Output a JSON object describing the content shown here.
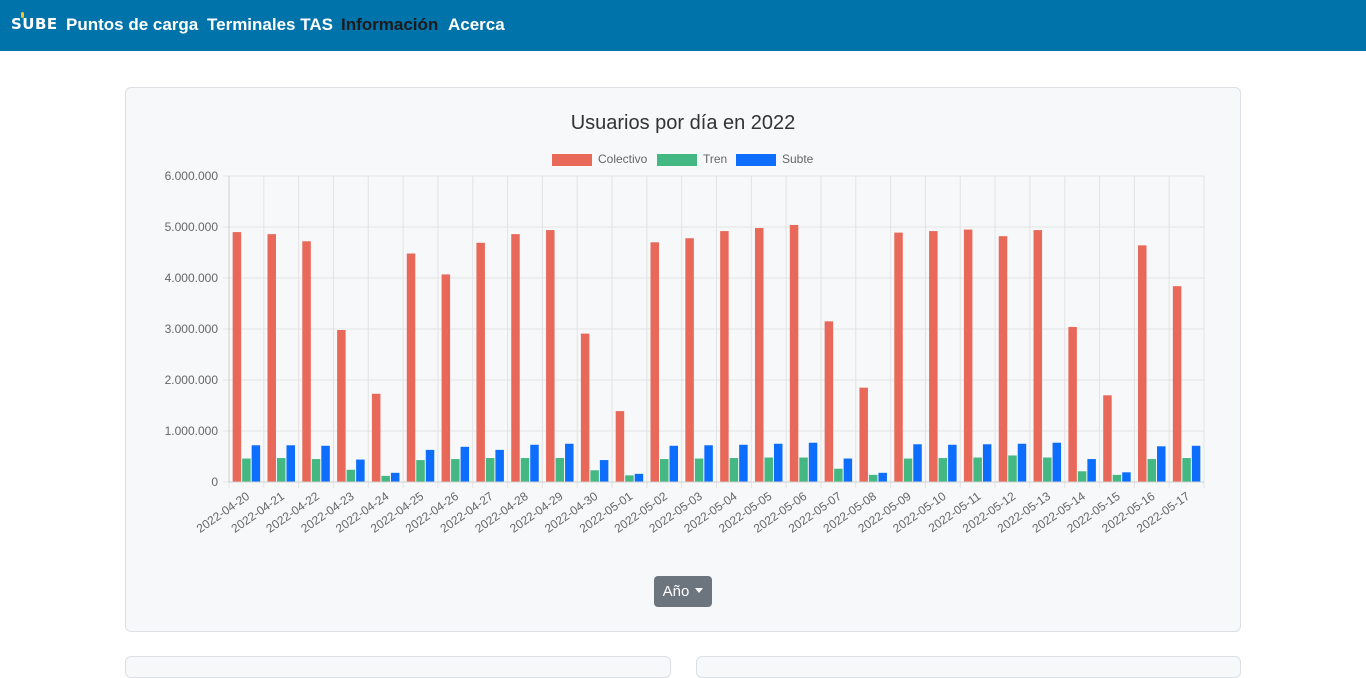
{
  "nav": {
    "brand": "SUBE",
    "links": [
      "Puntos de carga",
      "Terminales TAS",
      "Información",
      "Acerca"
    ],
    "active": "Información"
  },
  "dropdown": {
    "label": "Año"
  },
  "chart_data": {
    "type": "bar",
    "title": "Usuarios por día en 2022",
    "xlabel": "",
    "ylabel": "",
    "ylim": [
      0,
      6000000
    ],
    "yticks": [
      "0",
      "1.000.000",
      "2.000.000",
      "3.000.000",
      "4.000.000",
      "5.000.000",
      "6.000.000"
    ],
    "grid": true,
    "legend": "top",
    "categories": [
      "2022-04-20",
      "2022-04-21",
      "2022-04-22",
      "2022-04-23",
      "2022-04-24",
      "2022-04-25",
      "2022-04-26",
      "2022-04-27",
      "2022-04-28",
      "2022-04-29",
      "2022-04-30",
      "2022-05-01",
      "2022-05-02",
      "2022-05-03",
      "2022-05-04",
      "2022-05-05",
      "2022-05-06",
      "2022-05-07",
      "2022-05-08",
      "2022-05-09",
      "2022-05-10",
      "2022-05-11",
      "2022-05-12",
      "2022-05-13",
      "2022-05-14",
      "2022-05-15",
      "2022-05-16",
      "2022-05-17"
    ],
    "series": [
      {
        "name": "Colectivo",
        "color": "#e8695a",
        "values": [
          4900000,
          4860000,
          4720000,
          2980000,
          1730000,
          4480000,
          4070000,
          4690000,
          4860000,
          4940000,
          2910000,
          1390000,
          4700000,
          4780000,
          4920000,
          4980000,
          5040000,
          3150000,
          1850000,
          4890000,
          4920000,
          4950000,
          4820000,
          4940000,
          3040000,
          1700000,
          4640000,
          3840000
        ]
      },
      {
        "name": "Tren",
        "color": "#43b882",
        "values": [
          460000,
          470000,
          450000,
          240000,
          120000,
          430000,
          450000,
          470000,
          470000,
          470000,
          230000,
          130000,
          450000,
          460000,
          470000,
          480000,
          480000,
          260000,
          140000,
          460000,
          470000,
          480000,
          520000,
          480000,
          210000,
          140000,
          450000,
          470000
        ]
      },
      {
        "name": "Subte",
        "color": "#0d6efd",
        "values": [
          720000,
          720000,
          710000,
          440000,
          180000,
          630000,
          690000,
          630000,
          730000,
          750000,
          430000,
          160000,
          710000,
          720000,
          730000,
          750000,
          770000,
          460000,
          180000,
          740000,
          730000,
          740000,
          750000,
          770000,
          450000,
          190000,
          700000,
          710000
        ]
      }
    ]
  }
}
